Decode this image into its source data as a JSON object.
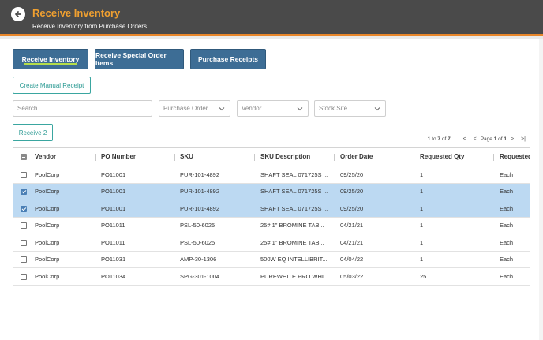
{
  "header": {
    "title": "Receive Inventory",
    "subtitle": "Receive Inventory from Purchase Orders.",
    "accent_color": "#e8862a",
    "back_icon": "back-arrow-icon"
  },
  "tabs": [
    {
      "label": "Receive Inventory",
      "active": true
    },
    {
      "label": "Receive Special Order Items",
      "active": false
    },
    {
      "label": "Purchase Receipts",
      "active": false
    }
  ],
  "actions": {
    "create_manual_receipt": "Create Manual Receipt",
    "receive": "Receive 2"
  },
  "filters": {
    "search_placeholder": "Search",
    "purchase_order": "Purchase Order",
    "vendor": "Vendor",
    "stock_site": "Stock Site"
  },
  "pager": {
    "range_start": "1",
    "to": "to",
    "range_end": "7",
    "of": "of",
    "total": "7",
    "page_label": "Page",
    "page": "1",
    "page_of": "of",
    "page_total": "1"
  },
  "table": {
    "columns": [
      "Vendor",
      "PO Number",
      "SKU",
      "SKU Description",
      "Order Date",
      "Requested Qty",
      "Requested"
    ],
    "rows": [
      {
        "selected": false,
        "vendor": "PoolCorp",
        "po": "PO11001",
        "sku": "PUR-101-4892",
        "desc": "SHAFT SEAL 071725S ...",
        "date": "09/25/20",
        "qty": "1",
        "uom": "Each"
      },
      {
        "selected": true,
        "vendor": "PoolCorp",
        "po": "PO11001",
        "sku": "PUR-101-4892",
        "desc": "SHAFT SEAL 071725S ...",
        "date": "09/25/20",
        "qty": "1",
        "uom": "Each"
      },
      {
        "selected": true,
        "vendor": "PoolCorp",
        "po": "PO11001",
        "sku": "PUR-101-4892",
        "desc": "SHAFT SEAL 071725S ...",
        "date": "09/25/20",
        "qty": "1",
        "uom": "Each"
      },
      {
        "selected": false,
        "vendor": "PoolCorp",
        "po": "PO11011",
        "sku": "PSL-50-6025",
        "desc": "25# 1\" BROMINE TAB...",
        "date": "04/21/21",
        "qty": "1",
        "uom": "Each"
      },
      {
        "selected": false,
        "vendor": "PoolCorp",
        "po": "PO11011",
        "sku": "PSL-50-6025",
        "desc": "25# 1\" BROMINE TAB...",
        "date": "04/21/21",
        "qty": "1",
        "uom": "Each"
      },
      {
        "selected": false,
        "vendor": "PoolCorp",
        "po": "PO11031",
        "sku": "AMP-30-1306",
        "desc": "500W EQ INTELLIBRIT...",
        "date": "04/04/22",
        "qty": "1",
        "uom": "Each"
      },
      {
        "selected": false,
        "vendor": "PoolCorp",
        "po": "PO11034",
        "sku": "SPG-301-1004",
        "desc": "PUREWHITE PRO WHI...",
        "date": "05/03/22",
        "qty": "25",
        "uom": "Each"
      }
    ]
  }
}
